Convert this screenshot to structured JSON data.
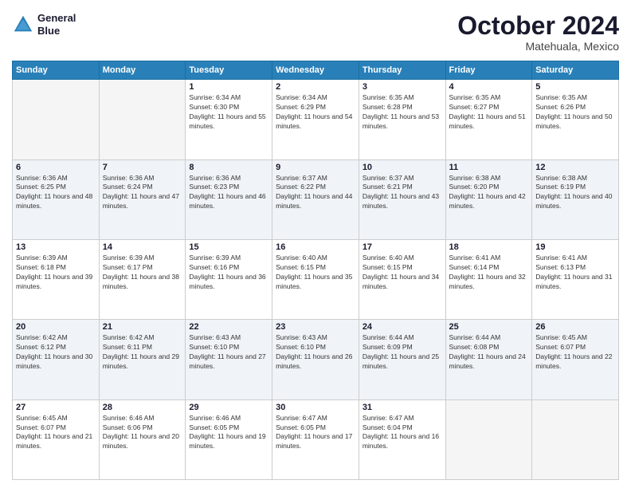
{
  "header": {
    "logo": {
      "line1": "General",
      "line2": "Blue"
    },
    "title": "October 2024",
    "location": "Matehuala, Mexico"
  },
  "weekdays": [
    "Sunday",
    "Monday",
    "Tuesday",
    "Wednesday",
    "Thursday",
    "Friday",
    "Saturday"
  ],
  "weeks": [
    [
      {
        "day": "",
        "empty": true
      },
      {
        "day": "",
        "empty": true
      },
      {
        "day": "1",
        "sunrise": "6:34 AM",
        "sunset": "6:30 PM",
        "daylight": "11 hours and 55 minutes."
      },
      {
        "day": "2",
        "sunrise": "6:34 AM",
        "sunset": "6:29 PM",
        "daylight": "11 hours and 54 minutes."
      },
      {
        "day": "3",
        "sunrise": "6:35 AM",
        "sunset": "6:28 PM",
        "daylight": "11 hours and 53 minutes."
      },
      {
        "day": "4",
        "sunrise": "6:35 AM",
        "sunset": "6:27 PM",
        "daylight": "11 hours and 51 minutes."
      },
      {
        "day": "5",
        "sunrise": "6:35 AM",
        "sunset": "6:26 PM",
        "daylight": "11 hours and 50 minutes."
      }
    ],
    [
      {
        "day": "6",
        "sunrise": "6:36 AM",
        "sunset": "6:25 PM",
        "daylight": "11 hours and 48 minutes."
      },
      {
        "day": "7",
        "sunrise": "6:36 AM",
        "sunset": "6:24 PM",
        "daylight": "11 hours and 47 minutes."
      },
      {
        "day": "8",
        "sunrise": "6:36 AM",
        "sunset": "6:23 PM",
        "daylight": "11 hours and 46 minutes."
      },
      {
        "day": "9",
        "sunrise": "6:37 AM",
        "sunset": "6:22 PM",
        "daylight": "11 hours and 44 minutes."
      },
      {
        "day": "10",
        "sunrise": "6:37 AM",
        "sunset": "6:21 PM",
        "daylight": "11 hours and 43 minutes."
      },
      {
        "day": "11",
        "sunrise": "6:38 AM",
        "sunset": "6:20 PM",
        "daylight": "11 hours and 42 minutes."
      },
      {
        "day": "12",
        "sunrise": "6:38 AM",
        "sunset": "6:19 PM",
        "daylight": "11 hours and 40 minutes."
      }
    ],
    [
      {
        "day": "13",
        "sunrise": "6:39 AM",
        "sunset": "6:18 PM",
        "daylight": "11 hours and 39 minutes."
      },
      {
        "day": "14",
        "sunrise": "6:39 AM",
        "sunset": "6:17 PM",
        "daylight": "11 hours and 38 minutes."
      },
      {
        "day": "15",
        "sunrise": "6:39 AM",
        "sunset": "6:16 PM",
        "daylight": "11 hours and 36 minutes."
      },
      {
        "day": "16",
        "sunrise": "6:40 AM",
        "sunset": "6:15 PM",
        "daylight": "11 hours and 35 minutes."
      },
      {
        "day": "17",
        "sunrise": "6:40 AM",
        "sunset": "6:15 PM",
        "daylight": "11 hours and 34 minutes."
      },
      {
        "day": "18",
        "sunrise": "6:41 AM",
        "sunset": "6:14 PM",
        "daylight": "11 hours and 32 minutes."
      },
      {
        "day": "19",
        "sunrise": "6:41 AM",
        "sunset": "6:13 PM",
        "daylight": "11 hours and 31 minutes."
      }
    ],
    [
      {
        "day": "20",
        "sunrise": "6:42 AM",
        "sunset": "6:12 PM",
        "daylight": "11 hours and 30 minutes."
      },
      {
        "day": "21",
        "sunrise": "6:42 AM",
        "sunset": "6:11 PM",
        "daylight": "11 hours and 29 minutes."
      },
      {
        "day": "22",
        "sunrise": "6:43 AM",
        "sunset": "6:10 PM",
        "daylight": "11 hours and 27 minutes."
      },
      {
        "day": "23",
        "sunrise": "6:43 AM",
        "sunset": "6:10 PM",
        "daylight": "11 hours and 26 minutes."
      },
      {
        "day": "24",
        "sunrise": "6:44 AM",
        "sunset": "6:09 PM",
        "daylight": "11 hours and 25 minutes."
      },
      {
        "day": "25",
        "sunrise": "6:44 AM",
        "sunset": "6:08 PM",
        "daylight": "11 hours and 24 minutes."
      },
      {
        "day": "26",
        "sunrise": "6:45 AM",
        "sunset": "6:07 PM",
        "daylight": "11 hours and 22 minutes."
      }
    ],
    [
      {
        "day": "27",
        "sunrise": "6:45 AM",
        "sunset": "6:07 PM",
        "daylight": "11 hours and 21 minutes."
      },
      {
        "day": "28",
        "sunrise": "6:46 AM",
        "sunset": "6:06 PM",
        "daylight": "11 hours and 20 minutes."
      },
      {
        "day": "29",
        "sunrise": "6:46 AM",
        "sunset": "6:05 PM",
        "daylight": "11 hours and 19 minutes."
      },
      {
        "day": "30",
        "sunrise": "6:47 AM",
        "sunset": "6:05 PM",
        "daylight": "11 hours and 17 minutes."
      },
      {
        "day": "31",
        "sunrise": "6:47 AM",
        "sunset": "6:04 PM",
        "daylight": "11 hours and 16 minutes."
      },
      {
        "day": "",
        "empty": true
      },
      {
        "day": "",
        "empty": true
      }
    ]
  ]
}
